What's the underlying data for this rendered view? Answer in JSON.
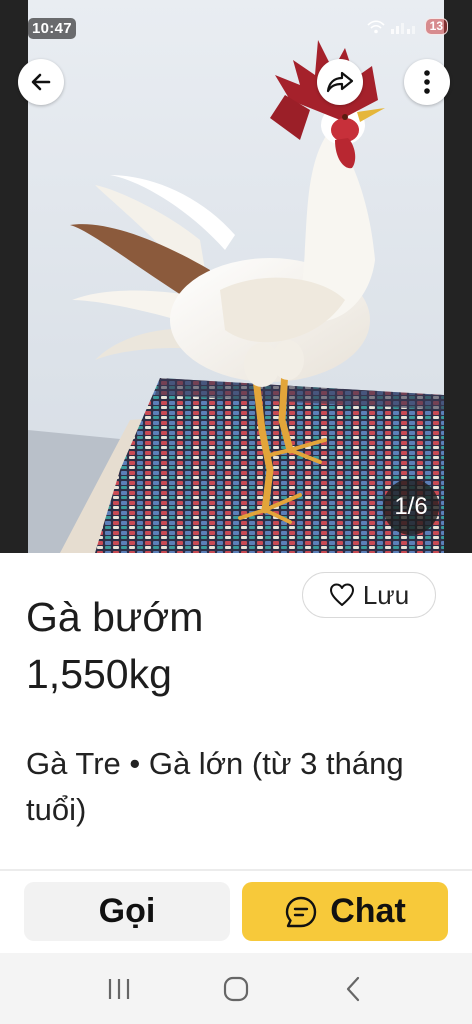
{
  "status_bar": {
    "time": "10:47",
    "notification_count": "13"
  },
  "gallery": {
    "counter": "1/6",
    "image_subject": "white rooster standing on a woven rug"
  },
  "toolbar": {
    "back_icon": "arrow-left-icon",
    "share_icon": "share-icon",
    "more_icon": "more-vertical-icon"
  },
  "listing": {
    "title": "Gà bướm 1,550kg",
    "category": "Gà Tre • Gà lớn (từ 3 tháng tuổi)",
    "save_label": "Lưu"
  },
  "actions": {
    "call_label": "Gọi",
    "chat_label": "Chat"
  },
  "colors": {
    "accent": "#f7c93a",
    "call_bg": "#f2f2f2"
  }
}
